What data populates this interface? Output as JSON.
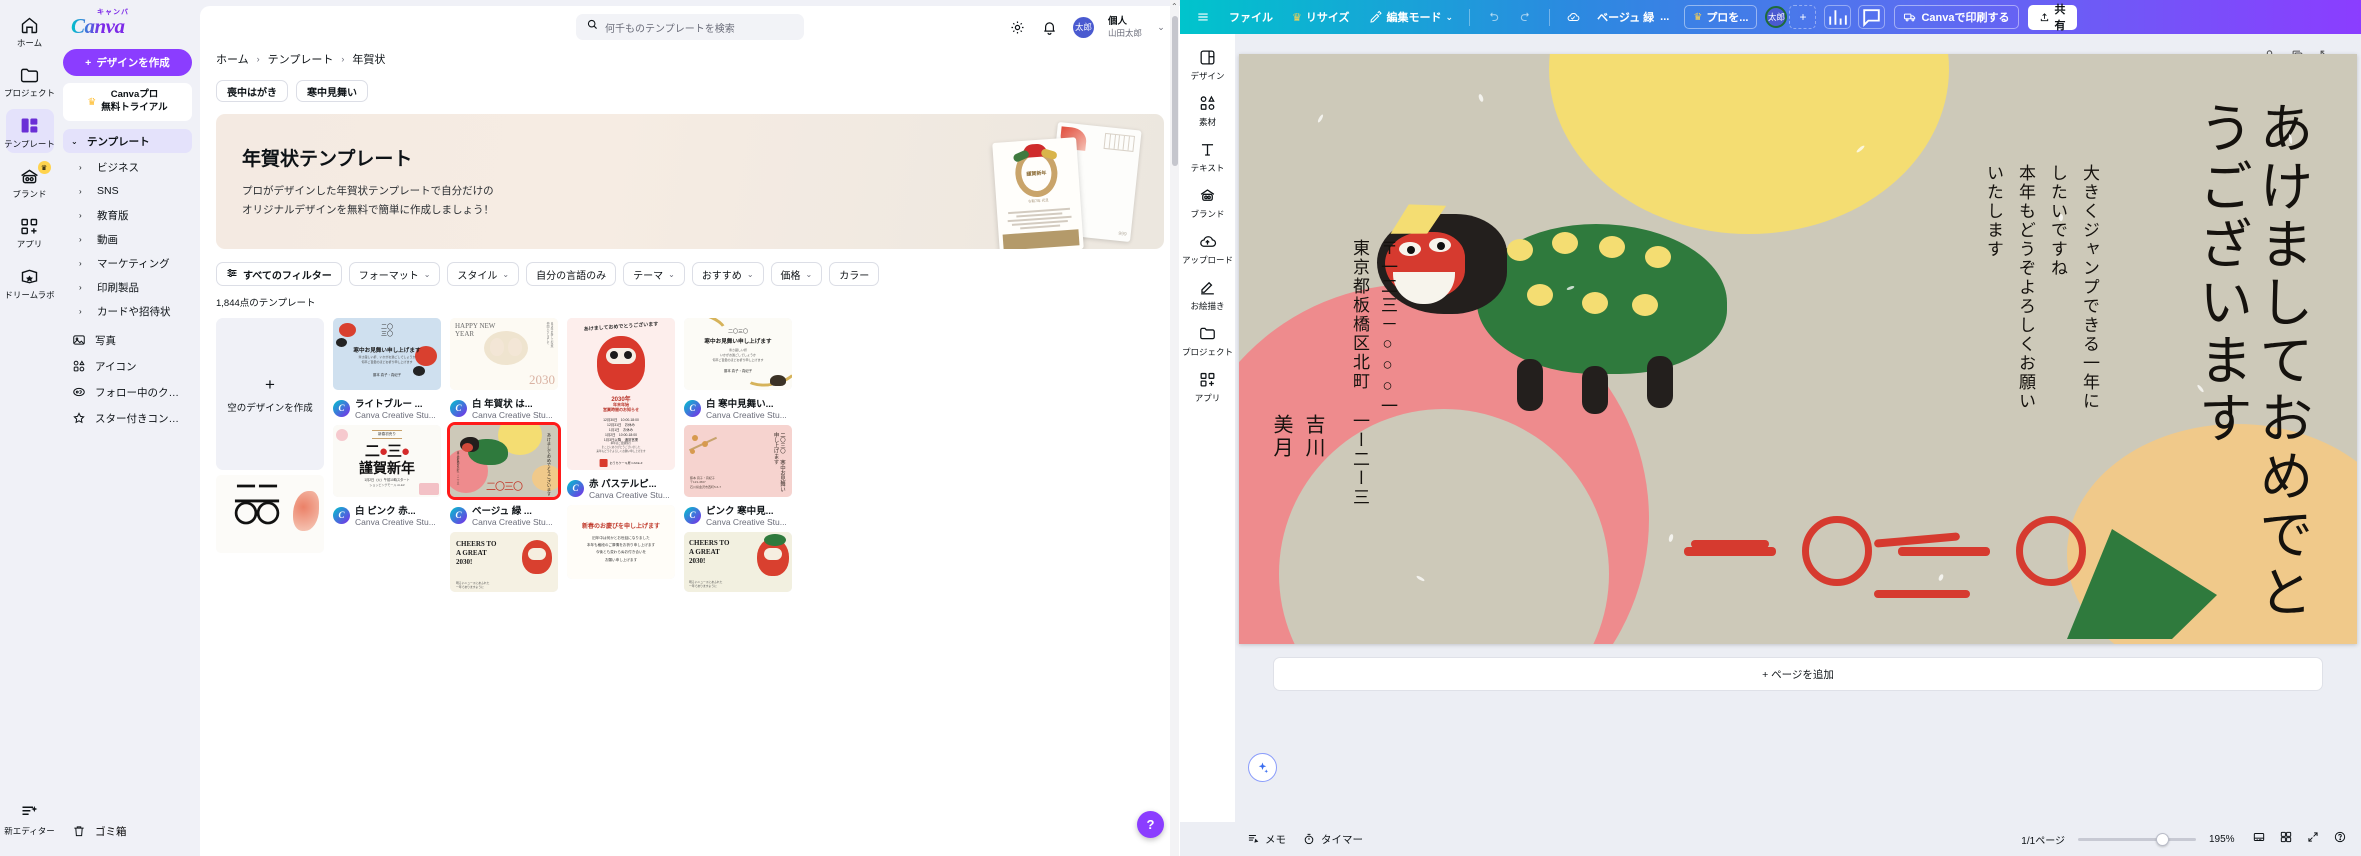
{
  "home": {
    "logo": {
      "kana": "キャンバ",
      "word": "Canva"
    },
    "rail": [
      {
        "label": "ホーム",
        "icon": "home-icon",
        "crown": false
      },
      {
        "label": "プロジェクト",
        "icon": "folder-icon",
        "crown": false
      },
      {
        "label": "テンプレート",
        "icon": "template-icon",
        "crown": false
      },
      {
        "label": "ブランド",
        "icon": "brand-icon",
        "crown": true
      },
      {
        "label": "アプリ",
        "icon": "apps-icon",
        "crown": false
      },
      {
        "label": "ドリームラボ",
        "icon": "dreamlab-icon",
        "crown": false
      }
    ],
    "rail_bottom": {
      "label": "新エディター",
      "icon": "new-editor-icon"
    },
    "create_button": "デザインを作成",
    "pro_card": {
      "line1": "Canvaプロ",
      "line2": "無料トライアル"
    },
    "nav_head": "テンプレート",
    "nav_sub": [
      "ビジネス",
      "SNS",
      "教育版",
      "動画",
      "マーケティング",
      "印刷製品",
      "カードや招待状"
    ],
    "nav_links": [
      {
        "label": "写真",
        "icon": "photo-icon"
      },
      {
        "label": "アイコン",
        "icon": "shapes-icon"
      },
      {
        "label": "フォロー中のクリエイ...",
        "icon": "creators-icon"
      },
      {
        "label": "スター付きコンテンツ",
        "icon": "star-icon"
      }
    ],
    "trash": "ゴミ箱",
    "search_placeholder": "何千ものテンプレートを検索",
    "user": {
      "initials": "太郎",
      "plan": "個人",
      "name": "山田太郎"
    },
    "breadcrumb": [
      "ホーム",
      "テンプレート",
      "年賀状"
    ],
    "pills": [
      "喪中はがき",
      "寒中見舞い"
    ],
    "hero": {
      "title": "年賀状テンプレート",
      "line1": "プロがデザインした年賀状テンプレートで自分だけの",
      "line2": "オリジナルデザインを無料で簡単に作成しましょう！",
      "card_text": "謹賀新年",
      "card_sub": "令和7年 元旦"
    },
    "filters": [
      {
        "label": "すべてのフィルター",
        "caret": false,
        "primary": true
      },
      {
        "label": "フォーマット",
        "caret": true
      },
      {
        "label": "スタイル",
        "caret": true
      },
      {
        "label": "自分の言語のみ",
        "caret": false
      },
      {
        "label": "テーマ",
        "caret": true
      },
      {
        "label": "おすすめ",
        "caret": true
      },
      {
        "label": "価格",
        "caret": true
      },
      {
        "label": "カラー",
        "caret": true
      }
    ],
    "count": "1,844点のテンプレート",
    "blank_tile": {
      "plus": "+",
      "label": "空のデザインを作成"
    },
    "author": "Canva Creative Stu...",
    "templates": {
      "col2": [
        {
          "title": "ライトブルー  ...",
          "author": "Canva Creative Stu...",
          "art": "kanchu-blue"
        },
        {
          "title": "白 ピンク 赤...",
          "author": "Canva Creative Stu...",
          "art": "kinga-white"
        },
        {
          "title": "",
          "author": "",
          "art": "koi-black"
        }
      ],
      "col3": [
        {
          "title": "白  年賀状  は...",
          "author": "Canva Creative Stu...",
          "art": "happy-new-year"
        },
        {
          "title": "ベージュ  緑  ...",
          "author": "Canva Creative Stu...",
          "art": "beige-green",
          "selected": true
        },
        {
          "title": "",
          "author": "",
          "art": "cheers-2030"
        }
      ],
      "col4": [
        {
          "title": "赤  パステルピ...",
          "author": "Canva Creative Stu...",
          "art": "daruma-red"
        },
        {
          "title": "",
          "author": "",
          "art": "shinshun-white"
        }
      ],
      "col5": [
        {
          "title": "白  寒中見舞い...",
          "author": "Canva Creative Stu...",
          "art": "kanchu-gold"
        },
        {
          "title": "ピンク  寒中見...",
          "author": "Canva Creative Stu...",
          "art": "kanchu-pink"
        },
        {
          "title": "",
          "author": "",
          "art": "cheers-daruma"
        }
      ]
    },
    "help_fab": "?"
  },
  "editor": {
    "menu": [
      {
        "label": "ファイル",
        "icon": "file-menu"
      },
      {
        "label": "リサイズ",
        "icon": "crown-icon"
      },
      {
        "label": "編集モード",
        "icon": "pencil-icon",
        "caret": true
      }
    ],
    "undo_icon": "undo-icon",
    "redo_icon": "redo-icon",
    "cloud_icon": "cloud-check-icon",
    "doc_title": "ベージュ  緑",
    "doc_title_more": "...",
    "pro_button": "プロを...",
    "avatar": "太郎",
    "add_collaborator": "+",
    "stats_icon": "analytics-icon",
    "comment_icon": "comment-icon",
    "print_button": "Canvaで印刷する",
    "share_button": "共有",
    "sidebar": [
      {
        "label": "デザイン",
        "icon": "design-icon"
      },
      {
        "label": "素材",
        "icon": "elements-icon"
      },
      {
        "label": "テキスト",
        "icon": "text-icon"
      },
      {
        "label": "ブランド",
        "icon": "brand-icon"
      },
      {
        "label": "アップロード",
        "icon": "upload-icon"
      },
      {
        "label": "お絵描き",
        "icon": "draw-icon"
      },
      {
        "label": "プロジェクト",
        "icon": "projects-icon"
      },
      {
        "label": "アプリ",
        "icon": "apps-icon"
      }
    ],
    "stage_tools": [
      "lock-icon",
      "duplicate-icon",
      "expand-icon"
    ],
    "canvas": {
      "greeting": "あけましておめでとうございます",
      "message_line1": "大きくジャンプできる一年に",
      "message_line2": "したいですね",
      "message_line3": "本年もどうぞよろしくお願い",
      "message_line4": "いたします",
      "postal": "〒一二三－○○○一",
      "address": "東京都板橋区北町 一ー二ー三",
      "name_last": "吉川",
      "name_first": "美月",
      "year_mark": "二〇三〇",
      "bg_color": "#cdc9b9",
      "accent_pink": "#ee8b8d",
      "accent_yellow": "#f4dd72",
      "accent_green": "#2f7a3d",
      "accent_orange": "#f0c98a",
      "accent_red": "#d63a2f"
    },
    "add_page": "+ ページを追加",
    "footer": {
      "notes": "メモ",
      "timer": "タイマー",
      "page_indicator": "1/1ページ",
      "zoom": "195%",
      "view_icons": [
        "fit-icon",
        "grid-icon",
        "fullscreen-icon",
        "help-icon"
      ]
    },
    "magic_fab": "magic-icon"
  }
}
